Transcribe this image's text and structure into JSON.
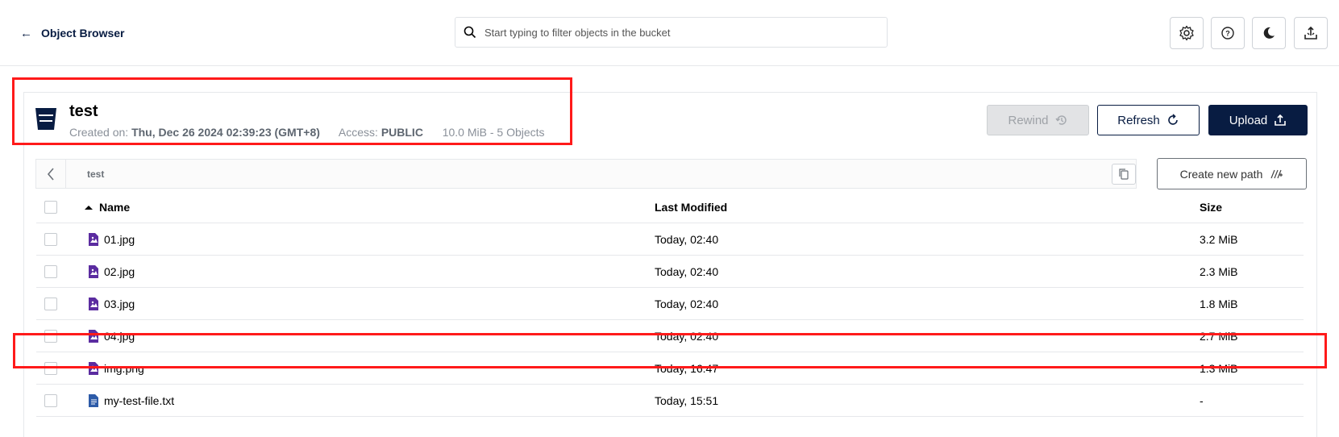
{
  "header": {
    "back_label": "Object Browser",
    "search_placeholder": "Start typing to filter objects in the bucket",
    "icons": [
      "gear-icon",
      "help-icon",
      "moon-icon",
      "upload-tray-icon"
    ]
  },
  "bucket": {
    "name": "test",
    "created_label": "Created on:",
    "created_value": "Thu, Dec 26 2024 02:39:23 (GMT+8)",
    "access_label": "Access:",
    "access_value": "PUBLIC",
    "usage": "10.0 MiB - 5 Objects"
  },
  "actions": {
    "rewind": "Rewind",
    "refresh": "Refresh",
    "upload": "Upload",
    "create_path": "Create new path"
  },
  "breadcrumb": {
    "path": "test"
  },
  "table": {
    "columns": {
      "name": "Name",
      "modified": "Last Modified",
      "size": "Size"
    },
    "rows": [
      {
        "name": "01.jpg",
        "modified": "Today, 02:40",
        "size": "3.2 MiB",
        "type": "image"
      },
      {
        "name": "02.jpg",
        "modified": "Today, 02:40",
        "size": "2.3 MiB",
        "type": "image"
      },
      {
        "name": "03.jpg",
        "modified": "Today, 02:40",
        "size": "1.8 MiB",
        "type": "image"
      },
      {
        "name": "04.jpg",
        "modified": "Today, 02:40",
        "size": "2.7 MiB",
        "type": "image"
      },
      {
        "name": "img.png",
        "modified": "Today, 16:47",
        "size": "1.3 MiB",
        "type": "image"
      },
      {
        "name": "my-test-file.txt",
        "modified": "Today, 15:51",
        "size": "-",
        "type": "text"
      }
    ]
  },
  "colors": {
    "primary": "#081c42",
    "image_icon": "#5b2ca0",
    "text_icon": "#2d5ba8",
    "highlight": "#ff1a1a"
  }
}
